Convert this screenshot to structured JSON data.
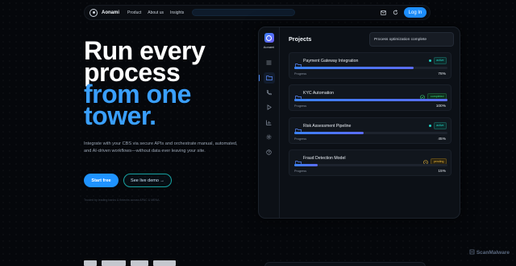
{
  "nav": {
    "brand": "Aonami",
    "links": [
      "Product",
      "About us",
      "Insights"
    ],
    "login_label": "Log In",
    "icons": [
      "mail-icon",
      "refresh-icon"
    ]
  },
  "hero": {
    "line1": "Run every",
    "line2": "process",
    "line3": "from one",
    "line4": "tower.",
    "subtitle": "Integrate with your CBS via secure APIs and orchestrate manual, automated, and AI-driven workflows—without data ever leaving your site.",
    "cta_primary": "Start free",
    "cta_secondary": "See live demo →",
    "trust_line": "Trusted by leading banks & fintechs across APAC & MENA."
  },
  "dashboard": {
    "sidebar_brand": "Aonami",
    "title": "Projects",
    "toast": "Process optimization complete",
    "progress_label": "Progress",
    "projects": [
      {
        "name": "Payment Gateway Integration",
        "status": "active",
        "progress": 78,
        "progress_text": "78%"
      },
      {
        "name": "KYC Automation",
        "status": "completed",
        "progress": 100,
        "progress_text": "100%"
      },
      {
        "name": "Risk Assessment Pipeline",
        "status": "active",
        "progress": 45,
        "progress_text": "45%"
      },
      {
        "name": "Fraud Detection Model",
        "status": "pending",
        "progress": 15,
        "progress_text": "15%"
      }
    ]
  },
  "colors": {
    "accent": "#1e90ff",
    "active": "#22d3c5",
    "completed": "#36d07a",
    "pending": "#e7b53a"
  },
  "watermark": "ScanMalware"
}
